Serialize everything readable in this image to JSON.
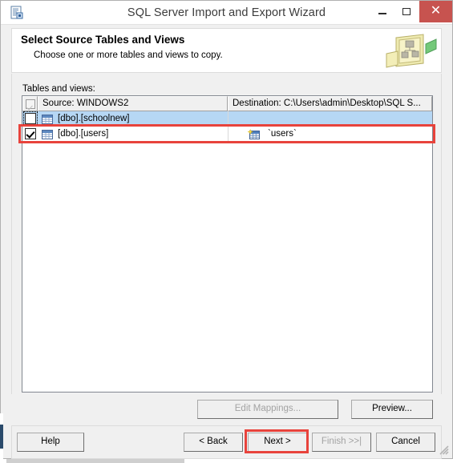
{
  "window": {
    "title": "SQL Server Import and Export Wizard",
    "icon": "wizard-document-icon",
    "controls": {
      "minimize": "–",
      "maximize": "□",
      "close": "✕"
    }
  },
  "banner": {
    "title": "Select Source Tables and Views",
    "subtitle": "Choose one or more tables and views to copy.",
    "art_icon": "tables-transfer-icon"
  },
  "list": {
    "label": "Tables and views:",
    "columns": [
      {
        "key": "check",
        "header": ""
      },
      {
        "key": "source",
        "header": "Source: WINDOWS2"
      },
      {
        "key": "destination",
        "header": "Destination: C:\\Users\\admin\\Desktop\\SQL S..."
      }
    ],
    "rows": [
      {
        "checked": false,
        "focused": true,
        "selected": true,
        "source_icon": "table-icon",
        "source": "[dbo].[schoolnew]",
        "dest_icon": "",
        "destination": ""
      },
      {
        "checked": true,
        "focused": false,
        "selected": false,
        "source_icon": "table-icon",
        "source": "[dbo].[users]",
        "dest_icon": "new-table-icon",
        "destination": "`users`"
      }
    ]
  },
  "actions": {
    "edit_mappings": "Edit Mappings...",
    "preview": "Preview...",
    "help": "Help",
    "back": "< Back",
    "next": "Next >",
    "finish": "Finish >>|",
    "cancel": "Cancel"
  },
  "colors": {
    "accent_red": "#e8433c",
    "selection_blue": "#b6d7f4",
    "close_button": "#c7534f",
    "dialog_face": "#f0f0f0"
  }
}
